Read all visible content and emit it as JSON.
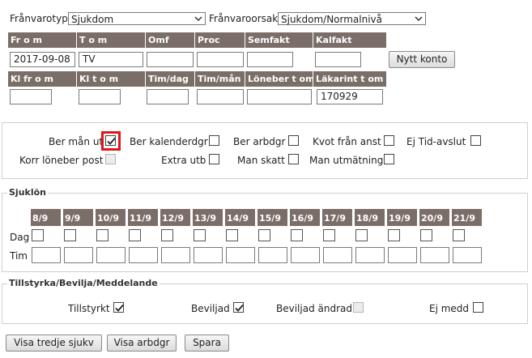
{
  "top": {
    "franvarotyp_label": "Frånvarotyp",
    "franvarotyp_value": "Sjukdom",
    "franvaroorsak_label": "Frånvaroorsak",
    "franvaroorsak_value": "Sjukdom/Normalnivå"
  },
  "row1": {
    "headers": [
      "Fr o m",
      "T o m",
      "Omf",
      "Proc",
      "Semfakt",
      "Kalfakt"
    ],
    "values": [
      "2017-09-08",
      "TV",
      "",
      "",
      "",
      ""
    ],
    "nytt_konto": "Nytt konto"
  },
  "row2": {
    "headers": [
      "Kl fr o m",
      "Kl t o m",
      "Tim/dag",
      "Tim/mån",
      "Löneber t om",
      "Läkarint t om"
    ],
    "values": [
      "",
      "",
      "",
      "",
      "",
      "170929"
    ]
  },
  "options": {
    "ber_man_ut": "Ber mån ut",
    "ber_kalenderdgr": "Ber kalenderdgr",
    "ber_arbdgr": "Ber arbdgr",
    "kvot_fran_anst": "Kvot från anst",
    "ej_tid_avslut": "Ej Tid-avslut",
    "korr_loneber_post": "Korr löneber post",
    "extra_utb": "Extra utb",
    "man_skatt": "Man skatt",
    "man_utmatning": "Man utmätning"
  },
  "sjuklon": {
    "legend": "Sjuklön",
    "dates": [
      "8/9",
      "9/9",
      "10/9",
      "11/9",
      "12/9",
      "13/9",
      "14/9",
      "15/9",
      "16/9",
      "17/9",
      "18/9",
      "19/9",
      "20/9",
      "21/9"
    ],
    "dag_label": "Dag",
    "tim_label": "Tim"
  },
  "tillstyrka": {
    "legend": "Tillstyrka/Bevilja/Meddelande",
    "tillstyrkt": "Tillstyrkt",
    "beviljad": "Beviljad",
    "beviljad_andrad": "Beviljad ändrad",
    "ej_medd": "Ej medd"
  },
  "buttons": {
    "visa_tredje_sjukv": "Visa tredje sjukv",
    "visa_arbdgr": "Visa arbdgr",
    "spara": "Spara"
  },
  "colors": {
    "header_bg": "#7b6e68",
    "highlight": "#e0161a"
  }
}
